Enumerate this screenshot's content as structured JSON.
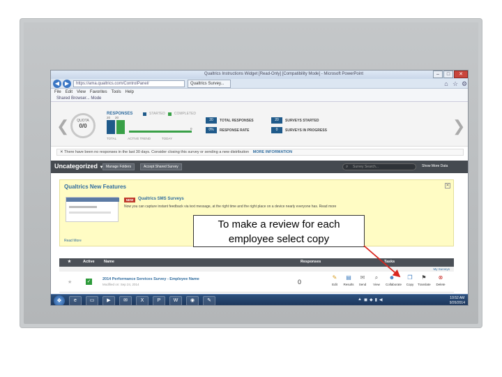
{
  "browser": {
    "window_title": "Qualtrics Instructions Widget [Read-Only] [Compatibility Mode] - Microsoft PowerPoint",
    "url": "https://ama.qualtrics.com/ControlPanel/",
    "tab_label": "Qualtrics Survey...",
    "menu": [
      "File",
      "Edit",
      "View",
      "Favorites",
      "Tools",
      "Help"
    ],
    "favorites_bar": "Shared Browser... Mode"
  },
  "dashboard": {
    "gauge_label": "QUOTA",
    "gauge_value": "0/0",
    "responses_title": "RESPONSES",
    "legend_started": "STARTED",
    "legend_completed": "COMPLETED",
    "bar_values": [
      "20",
      "20"
    ],
    "trend_end": "0",
    "summary_labels": [
      "TOTAL",
      "ACTIVE TREND",
      "TODAY"
    ],
    "total_responses_num": "20",
    "total_responses_label": "TOTAL RESPONSES",
    "surveys_started_num": "20",
    "surveys_started_label": "SURVEYS STARTED",
    "row2_left_num": "0%",
    "row2_left_label": "RESPONSE RATE",
    "row2_right_num": "0",
    "row2_right_label": "SURVEYS IN PROGRESS"
  },
  "notice": {
    "text": "There have been no responses in the last 30 days. Consider closing this survey or sending a new distribution",
    "link": "MORE INFORMATION"
  },
  "toolbar": {
    "folder": "Uncategorized",
    "manage_folders": "Manage Folders",
    "accept_shared": "Accept Shared Survey",
    "search_placeholder": "Survey Search...",
    "show_more": "Show More Data"
  },
  "features": {
    "title": "Qualtrics New Features",
    "new_badge": "NEW",
    "sms_title": "Qualtrics SMS Surveys",
    "sms_desc": "Now you can capture instant feedback via text message, at the right time and the right place on a device nearly everyone has. Read more",
    "read_more": "Read More"
  },
  "callout": {
    "line1": "To make a review for each",
    "line2": "employee select copy"
  },
  "table": {
    "headers": {
      "star": "★",
      "active": "Active",
      "name": "Name",
      "responses": "Responses",
      "tasks": "Tasks"
    },
    "subhead": "My Surveys",
    "row": {
      "name": "2014 Performance Services Survey - Employee Name",
      "modified": "Modified on: Sep 24, 2014",
      "responses": "0"
    },
    "actions": [
      "Edit",
      "Results",
      "Send",
      "View",
      "Collaborate",
      "Copy",
      "Translate",
      "Delete"
    ]
  },
  "taskbar": {
    "clock_time": "10:52 AM",
    "clock_date": "9/26/2014"
  },
  "colors": {
    "accent_blue": "#2e6b9e",
    "started": "#1f5a8a",
    "completed": "#39a047",
    "arrow_red": "#d9271f"
  }
}
